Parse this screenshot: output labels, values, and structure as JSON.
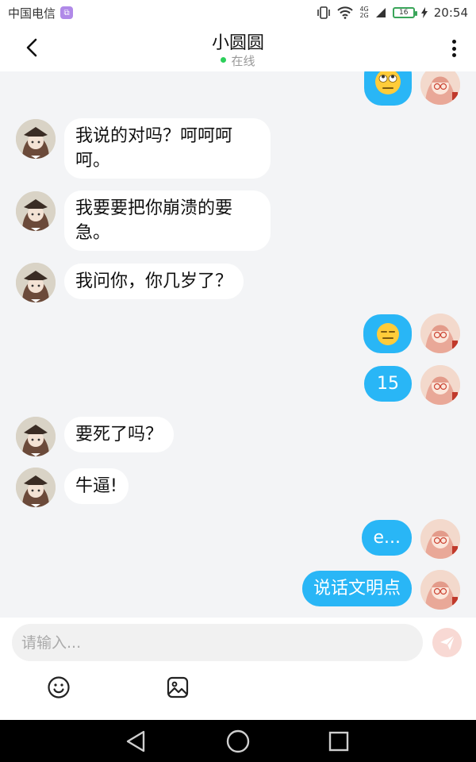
{
  "status_bar": {
    "carrier": "中国电信",
    "time": "20:54",
    "battery": "16",
    "network_top": "4G",
    "network_bottom": "2G"
  },
  "header": {
    "title": "小圆圆",
    "status": "在线"
  },
  "messages": [
    {
      "side": "out",
      "type": "emoji",
      "emoji": "rolling-eyes-emoji"
    },
    {
      "side": "in",
      "type": "text",
      "text": "我说的对吗？呵呵呵呵。"
    },
    {
      "side": "in",
      "type": "text",
      "text": "我要要把你崩溃的要急。"
    },
    {
      "side": "in",
      "type": "text",
      "text": "我问你，你几岁了？"
    },
    {
      "side": "out",
      "type": "emoji",
      "emoji": "expressionless-emoji"
    },
    {
      "side": "out",
      "type": "text",
      "text": "15"
    },
    {
      "side": "in",
      "type": "text",
      "text": "要死了吗？"
    },
    {
      "side": "in",
      "type": "text",
      "text": "牛逼!"
    },
    {
      "side": "out",
      "type": "text",
      "text": "e..."
    },
    {
      "side": "out",
      "type": "text",
      "text": "说话文明点"
    }
  ],
  "input": {
    "placeholder": "请输入..."
  },
  "colors": {
    "outgoing_bubble": "#29b6f6",
    "incoming_bubble": "#ffffff",
    "chat_background": "#f3f4f6",
    "online_dot": "#2ccf5a",
    "send_button": "#f8d9d4"
  }
}
